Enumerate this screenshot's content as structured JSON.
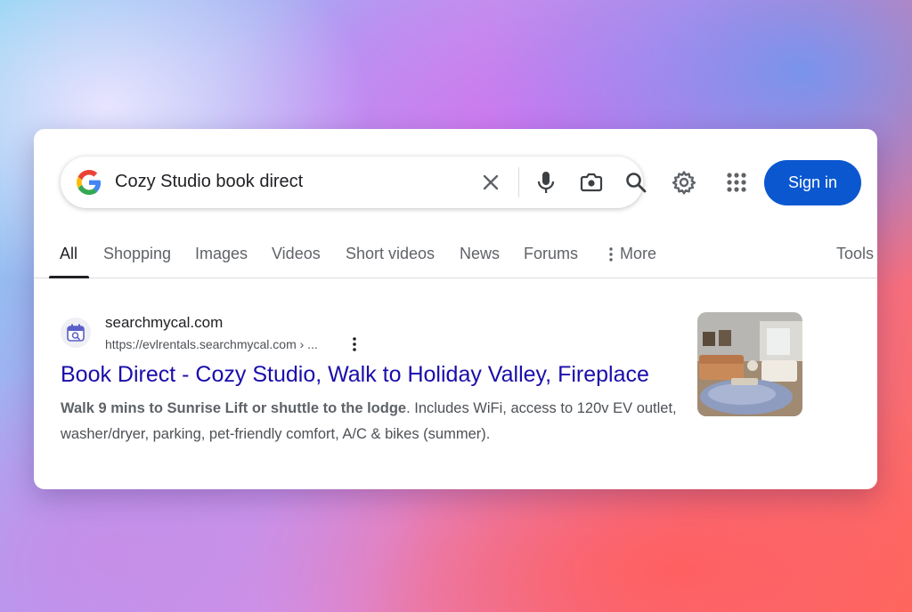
{
  "search": {
    "query": "Cozy Studio book direct"
  },
  "header": {
    "sign_in_label": "Sign in",
    "icons": [
      "google-logo",
      "close-icon",
      "mic-icon",
      "lens-icon",
      "search-icon",
      "gear-icon",
      "apps-grid-icon"
    ]
  },
  "tabs": {
    "items": [
      {
        "label": "All",
        "active": true
      },
      {
        "label": "Shopping"
      },
      {
        "label": "Images"
      },
      {
        "label": "Videos"
      },
      {
        "label": "Short videos"
      },
      {
        "label": "News"
      },
      {
        "label": "Forums"
      },
      {
        "label": "More"
      },
      {
        "label": "Tools"
      }
    ]
  },
  "result": {
    "site_name": "searchmycal.com",
    "url": "https://evlrentals.searchmycal.com › ...",
    "title": "Book Direct - Cozy Studio, Walk to Holiday Valley, Fireplace",
    "snippet_bold": "Walk 9 mins to Sunrise Lift or shuttle to the lodge",
    "snippet_rest": ". Includes WiFi, access to 120v EV outlet, washer/dryer, parking, pet-friendly comfort, A/C & bikes (summer)."
  },
  "colors": {
    "link": "#1a0dab",
    "sign_in_bg": "#0b57d0",
    "text": "#202124",
    "muted": "#5f6368"
  }
}
